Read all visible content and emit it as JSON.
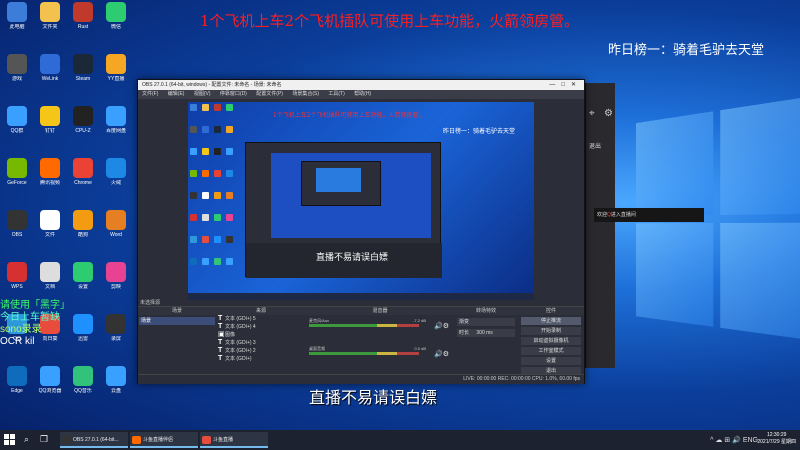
{
  "desktop": {
    "banner": "1个飞机上车2个飞机插队可使用上车功能，火箭领房管。",
    "rank": "昨日榜一：骑着毛驴去天堂",
    "caption": "直播不易请误白嫖",
    "overlay_note": [
      "请使用「黑字」",
      "今日上车暂缺",
      "sono录录",
      "OCR kil"
    ],
    "welcome_prefix": "欢迎",
    "welcome_user": "Q",
    "welcome_suffix": "进入直播间"
  },
  "icons": [
    {
      "name": "此电脑",
      "color": "#3b7dd8"
    },
    {
      "name": "文件夹",
      "color": "#f2c14e"
    },
    {
      "name": "Rust",
      "color": "#c0392b"
    },
    {
      "name": "微信",
      "color": "#2ecc71"
    },
    {
      "name": "游戏",
      "color": "#555555"
    },
    {
      "name": "WeLink",
      "color": "#2f6bd6"
    },
    {
      "name": "Steam",
      "color": "#1b2838"
    },
    {
      "name": "YY直播",
      "color": "#f5a623"
    },
    {
      "name": "QQ群",
      "color": "#3aa0ff"
    },
    {
      "name": "钉钉",
      "color": "#f5c518"
    },
    {
      "name": "CPU-Z",
      "color": "#222222"
    },
    {
      "name": "百度网盘",
      "color": "#3aa0ff"
    },
    {
      "name": "GeForce",
      "color": "#76b900"
    },
    {
      "name": "腾讯视频",
      "color": "#ff6a00"
    },
    {
      "name": "Chrome",
      "color": "#ea4335"
    },
    {
      "name": "火绒",
      "color": "#1e88e5"
    },
    {
      "name": "OBS",
      "color": "#333333"
    },
    {
      "name": "文件",
      "color": "#ffffff"
    },
    {
      "name": "酷狗",
      "color": "#f39c12"
    },
    {
      "name": "Word",
      "color": "#e67e22"
    },
    {
      "name": "WPS",
      "color": "#d63031"
    },
    {
      "name": "文档",
      "color": "#dddddd"
    },
    {
      "name": "设置",
      "color": "#2ecc71"
    },
    {
      "name": "剪映",
      "color": "#e84393"
    },
    {
      "name": "QQ",
      "color": "#2d98da"
    },
    {
      "name": "向日葵",
      "color": "#e74c3c"
    },
    {
      "name": "迅雷",
      "color": "#1e90ff"
    },
    {
      "name": "录屏",
      "color": "#333333"
    },
    {
      "name": "Edge",
      "color": "#0f6cbd"
    },
    {
      "name": "QQ浏览器",
      "color": "#3aa0ff"
    },
    {
      "name": "QQ音乐",
      "color": "#31c27c"
    },
    {
      "name": "云盘",
      "color": "#3aa0ff"
    }
  ],
  "live_panel": {
    "exit_label": "退出"
  },
  "obs": {
    "title": "OBS 27.0.1 (64-bit, windows) - 配置文件: 未命名 - 场景: 未命名",
    "menu": [
      "文件(F)",
      "编辑(E)",
      "视图(V)",
      "停靠窗口(D)",
      "配置文件(P)",
      "场景集合(S)",
      "工具(T)",
      "帮助(H)"
    ],
    "preview_banner": "1个飞机上车2个飞机插队可使用上车功能，火箭领房管。",
    "preview_rank": "昨日榜一：骑着毛驴去天堂",
    "preview_caption": "直播不易请误白嫖",
    "docks": {
      "scenes_title": "场景",
      "sources_title": "来源",
      "mixer_title": "混音器",
      "transitions_title": "转场特效",
      "controls_title": "控件",
      "dock_header": "未选择源"
    },
    "scenes": [
      "场景"
    ],
    "sources": [
      "文本 (GDI+) 5",
      "文本 (GDI+) 4",
      "图像",
      "文本 (GDI+) 3",
      "文本 (GDI+) 2",
      "文本 (GDI+)"
    ],
    "mixer": [
      {
        "name": "麦克风/Aux",
        "db": "-7.2 dB"
      },
      {
        "name": "桌面音频",
        "db": "0.0 dB"
      }
    ],
    "transitions": {
      "type": "渐变",
      "duration_label": "时长",
      "duration": "300 ms"
    },
    "controls": [
      "停止推流",
      "开始录制",
      "启动虚拟摄像机",
      "工作室模式",
      "设置",
      "退出"
    ],
    "status": "LIVE: 00:00:00   REC: 00:00:00   CPU: 1.0%, 60.00 fps"
  },
  "taskbar": {
    "apps": [
      {
        "label": "OBS 27.0.1 (64-bit...",
        "color": "#333333"
      },
      {
        "label": "斗鱼直播伴侣",
        "color": "#ff6a00"
      },
      {
        "label": "斗鱼直播",
        "color": "#e74c3c"
      }
    ],
    "tray_icons": "^ ☁ ⊞ 🔊 ENG",
    "time": "12:30:29",
    "date": "2021/7/29 星期四"
  }
}
